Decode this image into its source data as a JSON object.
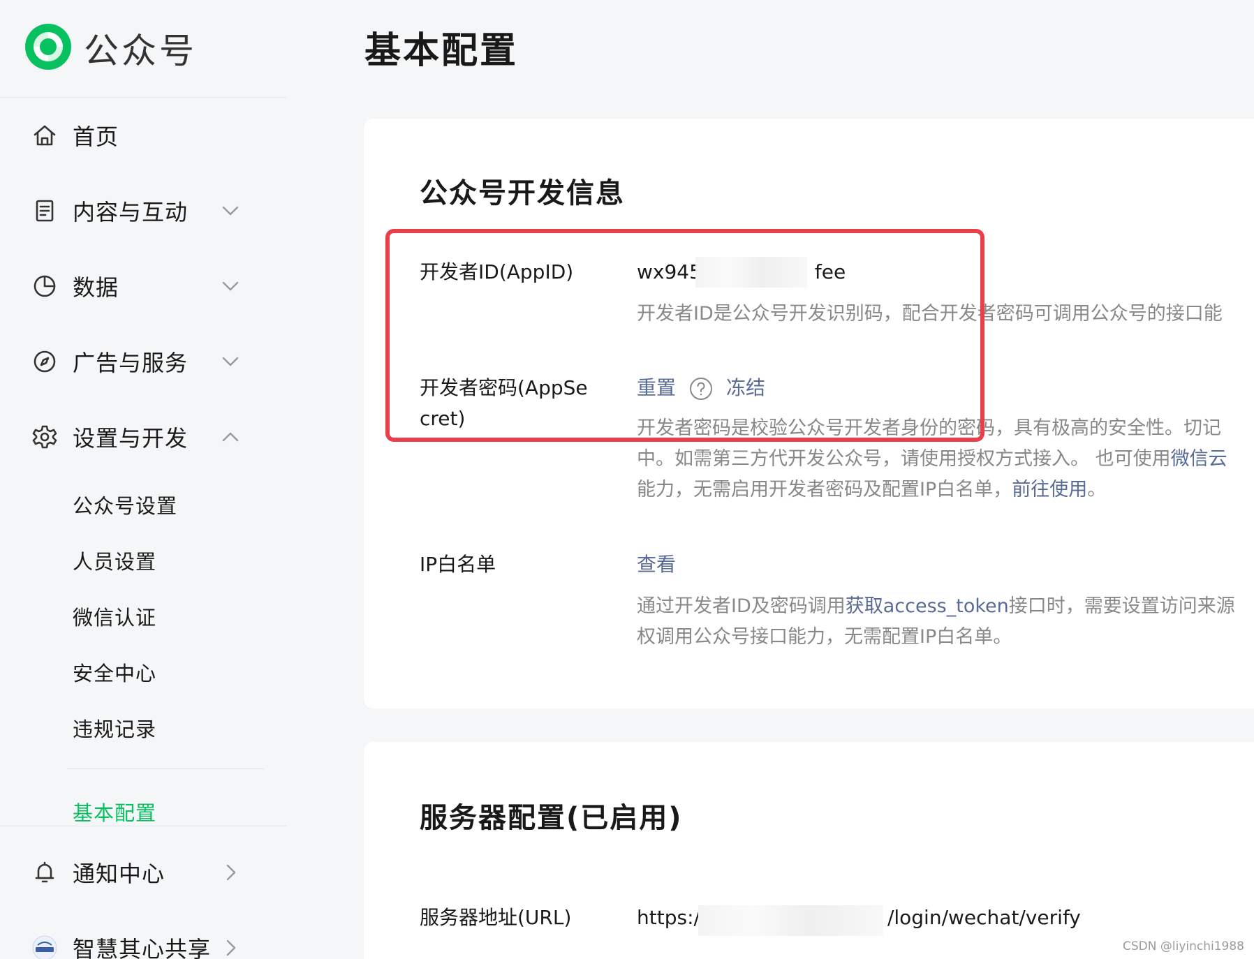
{
  "brand": {
    "name": "公众号"
  },
  "sidebar": {
    "items": [
      {
        "label": "首页",
        "icon": "home-icon"
      },
      {
        "label": "内容与互动",
        "icon": "document-icon",
        "chevron": "down"
      },
      {
        "label": "数据",
        "icon": "pie-chart-icon",
        "chevron": "down"
      },
      {
        "label": "广告与服务",
        "icon": "compass-icon",
        "chevron": "down"
      },
      {
        "label": "设置与开发",
        "icon": "gear-icon",
        "chevron": "up"
      }
    ],
    "subitems": [
      {
        "label": "公众号设置"
      },
      {
        "label": "人员设置"
      },
      {
        "label": "微信认证"
      },
      {
        "label": "安全中心"
      },
      {
        "label": "违规记录"
      }
    ],
    "active_subitem": {
      "label": "基本配置"
    },
    "bottom_items": [
      {
        "label": "通知中心",
        "icon": "bell-icon",
        "chevron": "right"
      },
      {
        "label": "智慧其心共享",
        "icon": "avatar",
        "chevron": "right"
      }
    ]
  },
  "page": {
    "title": "基本配置"
  },
  "dev_info": {
    "title": "公众号开发信息",
    "appid": {
      "label": "开发者ID(AppID)",
      "value_prefix": "wx945",
      "value_suffix": "fee",
      "desc": "开发者ID是公众号开发识别码，配合开发者密码可调用公众号的接口能"
    },
    "appsecret": {
      "label": "开发者密码(AppSecret)",
      "reset_link": "重置",
      "freeze_link": "冻结",
      "desc_line1": "开发者密码是校验公众号开发者身份的密码，具有极高的安全性。切记",
      "desc_line2_text": "中。如需第三方代开发公众号，请使用授权方式接入。 也可使用",
      "desc_line2_link": "微信云",
      "desc_line3_text": "能力，无需启用开发者密码及配置IP白名单，",
      "desc_line3_link": "前往使用",
      "desc_line3_end": "。"
    },
    "ip_whitelist": {
      "label": "IP白名单",
      "view_link": "查看",
      "desc_line1_text": "通过开发者ID及密码调用",
      "desc_line1_link": "获取access_token",
      "desc_line1_end": "接口时，需要设置访问来源",
      "desc_line2": "权调用公众号接口能力，无需配置IP白名单。"
    }
  },
  "server_config": {
    "title": "服务器配置(已启用)",
    "url": {
      "label": "服务器地址(URL)",
      "value_prefix": "https:/",
      "value_suffix": "/login/wechat/verify"
    }
  },
  "watermark": "CSDN @liyinchi1988",
  "colors": {
    "accent_green": "#07c160",
    "link_blue": "#576b95",
    "highlight_red": "#e8404a",
    "muted_text": "#888888"
  }
}
